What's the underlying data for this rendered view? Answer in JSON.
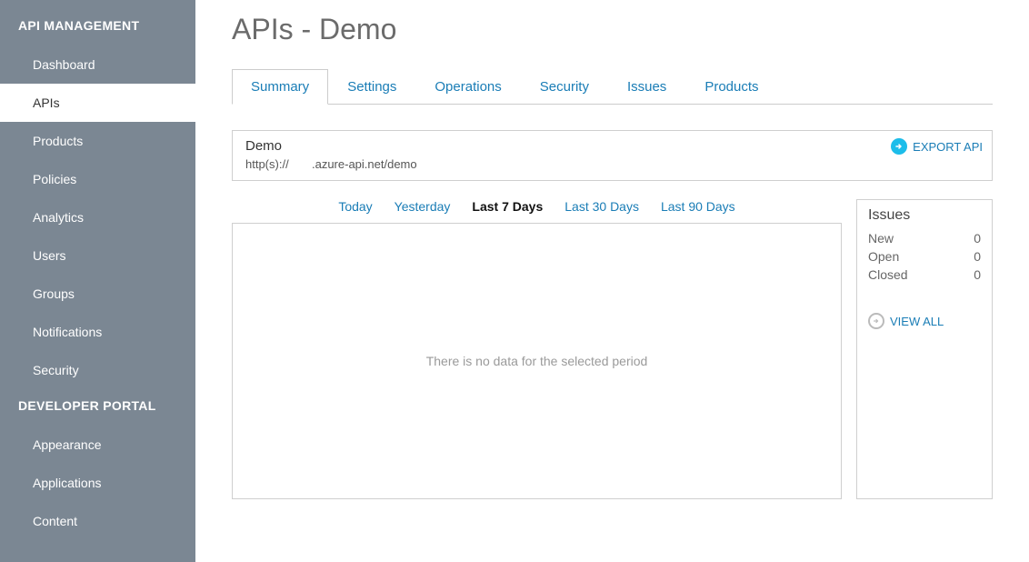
{
  "sidebar": {
    "heading1": "API MANAGEMENT",
    "items1": [
      {
        "label": "Dashboard",
        "name": "sidebar-item-dashboard"
      },
      {
        "label": "APIs",
        "name": "sidebar-item-apis",
        "active": true
      },
      {
        "label": "Products",
        "name": "sidebar-item-products"
      },
      {
        "label": "Policies",
        "name": "sidebar-item-policies"
      },
      {
        "label": "Analytics",
        "name": "sidebar-item-analytics"
      },
      {
        "label": "Users",
        "name": "sidebar-item-users"
      },
      {
        "label": "Groups",
        "name": "sidebar-item-groups"
      },
      {
        "label": "Notifications",
        "name": "sidebar-item-notifications"
      },
      {
        "label": "Security",
        "name": "sidebar-item-security"
      }
    ],
    "heading2": "DEVELOPER PORTAL",
    "items2": [
      {
        "label": "Appearance",
        "name": "sidebar-item-appearance"
      },
      {
        "label": "Applications",
        "name": "sidebar-item-applications"
      },
      {
        "label": "Content",
        "name": "sidebar-item-content"
      }
    ]
  },
  "page": {
    "title": "APIs - Demo"
  },
  "tabs": [
    {
      "label": "Summary",
      "name": "tab-summary",
      "active": true
    },
    {
      "label": "Settings",
      "name": "tab-settings"
    },
    {
      "label": "Operations",
      "name": "tab-operations"
    },
    {
      "label": "Security",
      "name": "tab-security"
    },
    {
      "label": "Issues",
      "name": "tab-issues"
    },
    {
      "label": "Products",
      "name": "tab-products"
    }
  ],
  "urlbox": {
    "name": "Demo",
    "scheme": "http(s)://",
    "suffix": ".azure-api.net/demo",
    "export_label": "EXPORT API"
  },
  "ranges": [
    {
      "label": "Today",
      "name": "range-today"
    },
    {
      "label": "Yesterday",
      "name": "range-yesterday"
    },
    {
      "label": "Last 7 Days",
      "name": "range-7days",
      "active": true
    },
    {
      "label": "Last 30 Days",
      "name": "range-30days"
    },
    {
      "label": "Last 90 Days",
      "name": "range-90days"
    }
  ],
  "chart": {
    "empty_message": "There is no data for the selected period"
  },
  "issues": {
    "title": "Issues",
    "rows": [
      {
        "label": "New",
        "value": "0"
      },
      {
        "label": "Open",
        "value": "0"
      },
      {
        "label": "Closed",
        "value": "0"
      }
    ],
    "view_all_label": "VIEW ALL"
  }
}
